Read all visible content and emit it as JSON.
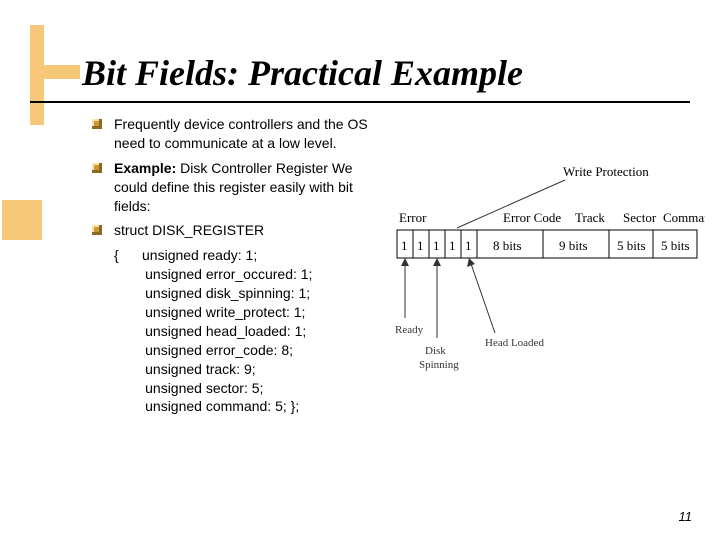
{
  "title": "Bit Fields: Practical Example",
  "bullets": {
    "b1": "Frequently device controllers and the OS need to communicate at a low level.",
    "b2_label": "Example:",
    "b2_rest": " Disk Controller Register We could define this register easily with bit fields:",
    "b3": "struct DISK_REGISTER"
  },
  "code": "{      unsigned ready: 1;\n        unsigned error_occured: 1;\n        unsigned disk_spinning: 1;\n        unsigned write_protect: 1;\n        unsigned head_loaded: 1;\n        unsigned error_code: 8;\n        unsigned track: 9;\n        unsigned sector: 5;\n        unsigned command: 5; };",
  "diagram": {
    "top_label": "Write Protection",
    "labels": {
      "error": "Error",
      "error_code": "Error Code",
      "track": "Track",
      "sector": "Sector",
      "command": "Command"
    },
    "cells": {
      "c1": "1",
      "c2": "1",
      "c3": "1",
      "c4": "1",
      "c5": "1",
      "c6": "8 bits",
      "c7": "9 bits",
      "c8": "5 bits",
      "c9": "5 bits"
    },
    "bottom": {
      "ready": "Ready",
      "disk": "Disk",
      "spinning": "Spinning",
      "head": "Head Loaded"
    }
  },
  "page": "11"
}
